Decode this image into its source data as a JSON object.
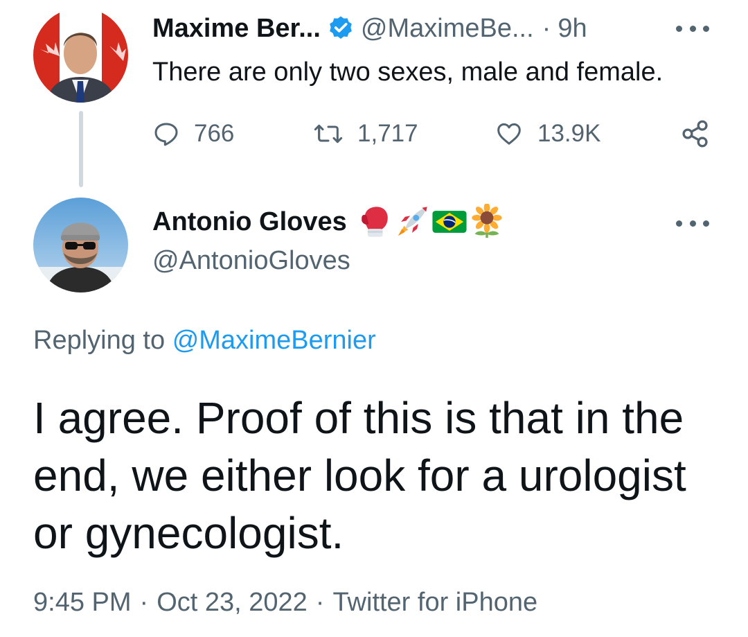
{
  "parent_tweet": {
    "author_name": "Maxime Ber...",
    "handle": "@MaximeBe...",
    "separator": "·",
    "time": "9h",
    "text": "There are only two sexes, male and female.",
    "actions": {
      "replies": "766",
      "retweets": "1,717",
      "likes": "13.9K"
    },
    "verified": true
  },
  "reply_tweet": {
    "author_name": "Antonio Gloves",
    "name_emojis": [
      "boxing-glove-emoji",
      "rocket-emoji",
      "brazil-flag-emoji",
      "sunflower-emoji"
    ],
    "handle": "@AntonioGloves",
    "replying_to_label": "Replying to",
    "replying_to_mention": "@MaximeBernier",
    "text": "I agree. Proof of this is that in the end, we either look for a urologist or gynecologist.",
    "time": "9:45 PM",
    "date": "Oct 23, 2022",
    "client": "Twitter for iPhone",
    "meta_separator": "·"
  },
  "colors": {
    "text_primary": "#0f1419",
    "text_secondary": "#536471",
    "accent": "#1d9bf0",
    "thread_line": "#cfd9de"
  }
}
